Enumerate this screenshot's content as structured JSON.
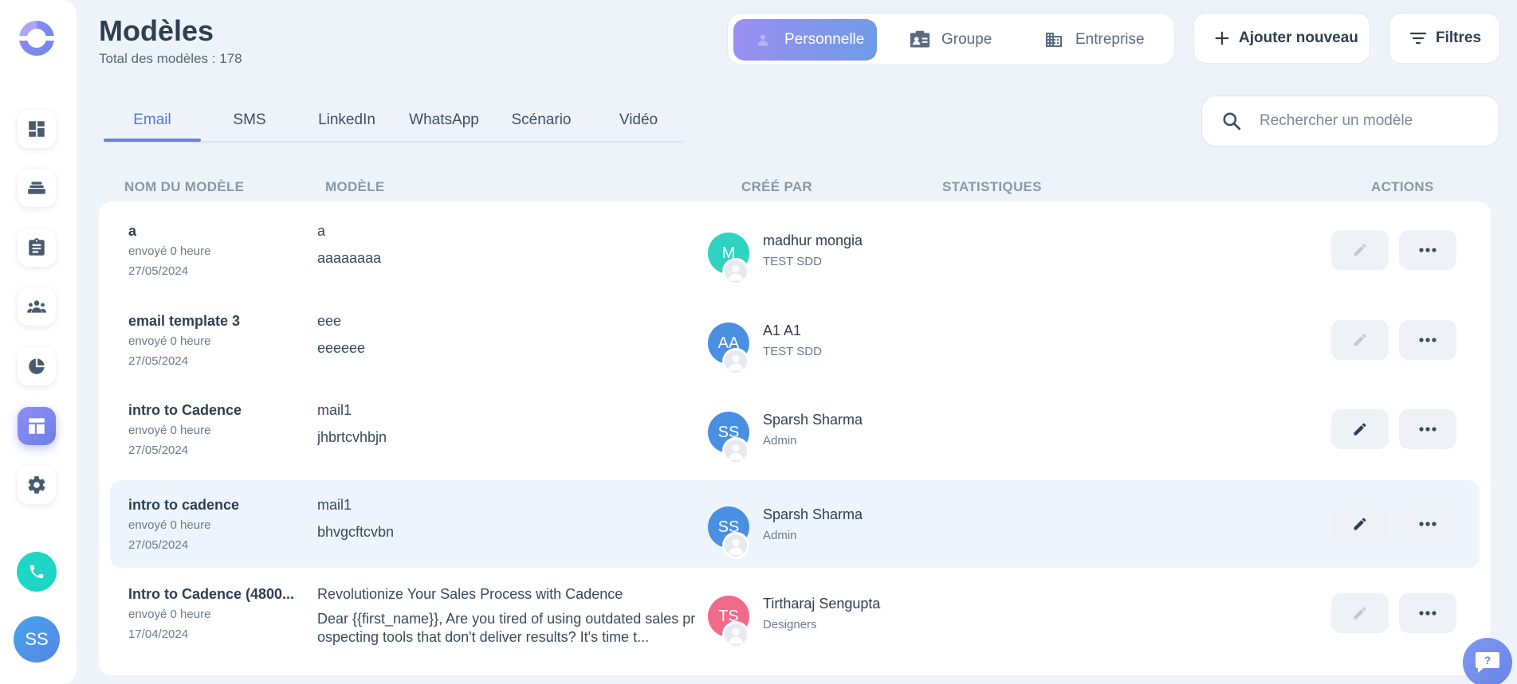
{
  "header": {
    "title": "Modèles",
    "subtitle": "Total des modèles : 178"
  },
  "scope_tabs": [
    {
      "label": "Personnelle",
      "active": true
    },
    {
      "label": "Groupe",
      "active": false
    },
    {
      "label": "Entreprise",
      "active": false
    }
  ],
  "actions": {
    "add_label": "Ajouter nouveau",
    "filters_label": "Filtres"
  },
  "tabs": [
    {
      "label": "Email",
      "active": true
    },
    {
      "label": "SMS",
      "active": false
    },
    {
      "label": "LinkedIn",
      "active": false
    },
    {
      "label": "WhatsApp",
      "active": false
    },
    {
      "label": "Scénario",
      "active": false
    },
    {
      "label": "Vidéo",
      "active": false
    }
  ],
  "search": {
    "placeholder": "Rechercher un modèle"
  },
  "columns": [
    "NOM DU MODÈLE",
    "MODÈLE",
    "CRÉÉ PAR",
    "STATISTIQUES",
    "ACTIONS"
  ],
  "rows": [
    {
      "name": "a",
      "sent": "envoyé 0 heure",
      "date": "27/05/2024",
      "subject": "a",
      "body": "aaaaaaaa",
      "initials": "M",
      "avatar_color": "#2fd3c0",
      "creator": "madhur mongia",
      "team": "TEST SDD",
      "edit_enabled": false
    },
    {
      "name": "email template 3",
      "sent": "envoyé 0 heure",
      "date": "27/05/2024",
      "subject": "eee",
      "body": "eeeeee",
      "initials": "AA",
      "avatar_color": "#4a90e2",
      "creator": "A1 A1",
      "team": "TEST SDD",
      "edit_enabled": false
    },
    {
      "name": "intro to Cadence",
      "sent": "envoyé 0 heure",
      "date": "27/05/2024",
      "subject": "mail1",
      "body": "jhbrtcvhbjn",
      "initials": "SS",
      "avatar_color": "#4a90e2",
      "creator": "Sparsh Sharma",
      "team": "Admin",
      "edit_enabled": true
    },
    {
      "name": "intro to cadence",
      "sent": "envoyé 0 heure",
      "date": "27/05/2024",
      "subject": "mail1",
      "body": "bhvgcftcvbn",
      "initials": "SS",
      "avatar_color": "#4a90e2",
      "creator": "Sparsh Sharma",
      "team": "Admin",
      "edit_enabled": true
    },
    {
      "name": "Intro to Cadence (4800...",
      "sent": "envoyé 0 heure",
      "date": "17/04/2024",
      "subject": "Revolutionize Your Sales Process with Cadence",
      "body": "Dear {{first_name}},   Are you tired of using outdated sales prospecting tools that don't deliver results? It's time t...",
      "initials": "TS",
      "avatar_color": "#f06b8a",
      "creator": "Tirtharaj Sengupta",
      "team": "Designers",
      "edit_enabled": false
    }
  ],
  "user": {
    "initials": "SS"
  }
}
